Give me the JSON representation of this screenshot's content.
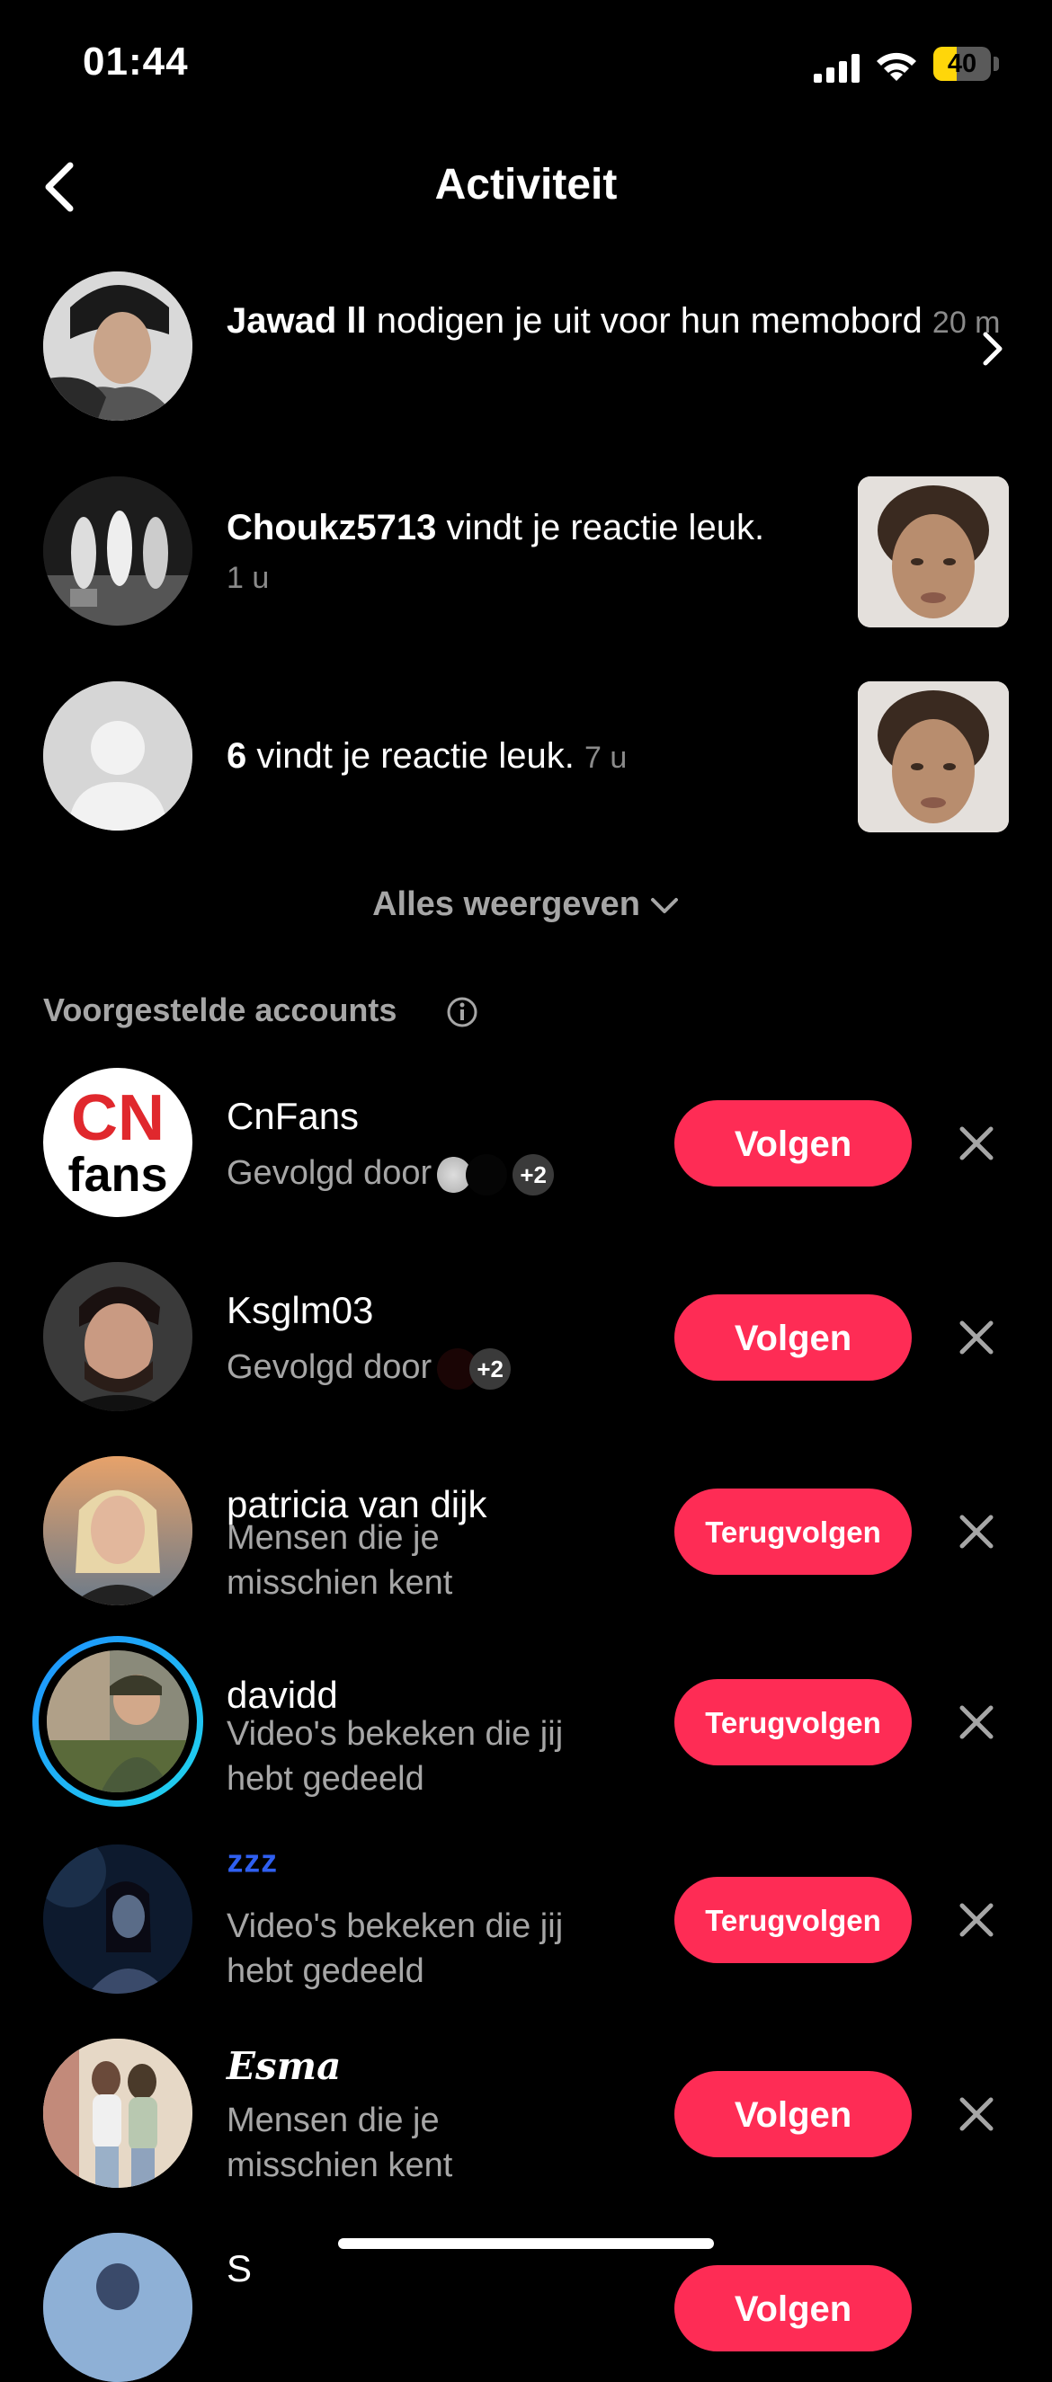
{
  "status_bar": {
    "time": "01:44",
    "battery": "40",
    "battery_level": 0.4
  },
  "header": {
    "title": "Activiteit"
  },
  "activity": [
    {
      "user": "Jawad ll",
      "text": " nodigen je uit voor hun memobord",
      "time": "20 m"
    },
    {
      "user": "Choukz5713",
      "text": " vindt je reactie leuk.",
      "time": "1 u"
    },
    {
      "user": "6",
      "text": " vindt je reactie leuk.",
      "time": "7 u"
    }
  ],
  "see_all": "Alles weergeven",
  "suggested": {
    "title": "Voorgestelde accounts",
    "accounts": [
      {
        "name": "CnFans",
        "subtitle": "Gevolgd door",
        "extra": "+2",
        "button": "Volgen",
        "avatar_text_top": "CN",
        "avatar_text_bottom": "fans"
      },
      {
        "name": "Ksglm03",
        "subtitle": "Gevolgd door",
        "extra": "+2",
        "button": "Volgen"
      },
      {
        "name": "patricia van dijk",
        "subtitle_line1": "Mensen die je",
        "subtitle_line2": "misschien kent",
        "button": "Terugvolgen"
      },
      {
        "name": "davidd",
        "subtitle_line1": "Video's bekeken die jij",
        "subtitle_line2": "hebt gedeeld",
        "button": "Terugvolgen"
      },
      {
        "name": "ᶻᶻᶻ",
        "subtitle_line1": "Video's bekeken die jij",
        "subtitle_line2": "hebt gedeeld",
        "button": "Terugvolgen"
      },
      {
        "name": "𝑬𝒔𝒎𝒂",
        "subtitle_line1": "Mensen die je",
        "subtitle_line2": "misschien kent",
        "button": "Volgen"
      },
      {
        "name": "S",
        "button": "Volgen"
      }
    ]
  },
  "colors": {
    "accent": "#fe2c55",
    "background": "#000000",
    "muted": "#8a8a8a",
    "story_ring": "#20d5ec"
  }
}
